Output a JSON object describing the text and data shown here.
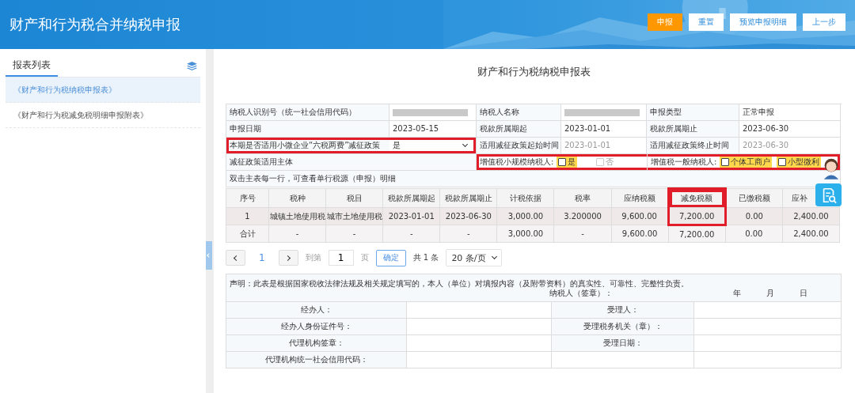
{
  "header": {
    "title": "财产和行为税合并纳税申报",
    "buttons": [
      {
        "label": "申报",
        "kind": "primary"
      },
      {
        "label": "重置",
        "kind": "default"
      },
      {
        "label": "预览申报明细",
        "kind": "default"
      },
      {
        "label": "上一步",
        "kind": "default"
      }
    ]
  },
  "sidebar": {
    "title": "报表列表",
    "items": [
      {
        "label": "《财产和行为税纳税申报表》",
        "selected": true
      },
      {
        "label": "《财产和行为税减免税明细申报附表》",
        "selected": false
      }
    ]
  },
  "form": {
    "title": "财产和行为税纳税申报表",
    "info_rows": [
      [
        {
          "kind": "label",
          "text": "纳税人识别号（统一社会信用代码）"
        },
        {
          "kind": "redacted"
        },
        {
          "kind": "label",
          "text": "纳税人名称"
        },
        {
          "kind": "redacted"
        },
        {
          "kind": "label",
          "text": "申报类型"
        },
        {
          "kind": "value",
          "text": "正常申报"
        }
      ],
      [
        {
          "kind": "label",
          "text": "申报日期"
        },
        {
          "kind": "value",
          "text": "2023-05-15"
        },
        {
          "kind": "label",
          "text": "税款所属期起"
        },
        {
          "kind": "value",
          "text": "2023-01-01"
        },
        {
          "kind": "label",
          "text": "税款所属期止"
        },
        {
          "kind": "value",
          "text": "2023-06-30"
        }
      ],
      [
        {
          "kind": "label_select",
          "text": "本期是否适用小微企业“六税两费”减征政策",
          "value": "是",
          "highlighted": true
        },
        {
          "kind": "label",
          "text": "适用减征政策起始时间"
        },
        {
          "kind": "value",
          "text": "2023-01-01",
          "disabled": true
        },
        {
          "kind": "label",
          "text": "适用减征政策终止时间"
        },
        {
          "kind": "value",
          "text": "2023-06-30",
          "disabled": true
        }
      ],
      [
        {
          "kind": "wide_label",
          "text": "减征政策适用主体"
        },
        {
          "kind": "checks",
          "highlighted": true,
          "groups": [
            {
              "label": "增值税小规模纳税人:",
              "options": [
                {
                  "label": "是",
                  "checked": false,
                  "disabled": false
                },
                {
                  "label": "否",
                  "checked": false,
                  "disabled": true
                }
              ]
            },
            {
              "label": "增值税一般纳税人:",
              "options": [
                {
                  "label": "个体工商户",
                  "checked": false,
                  "disabled": false
                },
                {
                  "label": "小型微利",
                  "checked": false,
                  "disabled": false
                }
              ]
            }
          ]
        }
      ],
      [
        {
          "kind": "note",
          "text": "双击主表每一行，可查看单行税源（申报）明细"
        }
      ]
    ],
    "columns": [
      {
        "label": "序号",
        "highlighted": false
      },
      {
        "label": "税种",
        "highlighted": false
      },
      {
        "label": "税目",
        "highlighted": false
      },
      {
        "label": "税款所属期起",
        "highlighted": false
      },
      {
        "label": "税款所属期止",
        "highlighted": false
      },
      {
        "label": "计税依据",
        "highlighted": false
      },
      {
        "label": "税率",
        "highlighted": false
      },
      {
        "label": "应纳税额",
        "highlighted": false
      },
      {
        "label": "减免税额",
        "highlighted": true
      },
      {
        "label": "已缴税额",
        "highlighted": false
      },
      {
        "label": "应补",
        "highlighted": false
      }
    ],
    "rows": [
      {
        "kind": "data",
        "cells": [
          "1",
          "城镇土地使用税",
          "城市土地使用税",
          "2023-01-01",
          "2023-06-30",
          "3,000.00",
          "3.200000",
          "9,600.00",
          "7,200.00",
          "0.00",
          "2,400.00"
        ]
      },
      {
        "kind": "total",
        "cells": [
          "合计",
          "-",
          "-",
          "-",
          "-",
          "3,000.00",
          "-",
          "9,600.00",
          "7,200.00",
          "0.00",
          "2,400.00"
        ]
      }
    ],
    "pagination": {
      "pages": [
        {
          "label": "1",
          "selected": true
        }
      ],
      "goto_label": "到第",
      "goto_value": "1",
      "page_unit": "页",
      "confirm": "确定",
      "total": "共 1 条",
      "page_size": "20 条/页"
    },
    "declaration": {
      "statement": "声明：此表是根据国家税收法律法规及相关规定填写的，本人（单位）对填报内容（及附带资料）的真实性、可靠性、完整性负责。",
      "signer": "纳税人（签章）：",
      "year": "年",
      "month": "月",
      "day": "日",
      "rows": [
        [
          "经办人：",
          "受理人："
        ],
        [
          "经办人身份证件号：",
          "受理税务机关（章）："
        ],
        [
          "代理机构签章：",
          "受理日期："
        ],
        [
          "代理机构统一社会信用代码："
        ]
      ]
    }
  }
}
